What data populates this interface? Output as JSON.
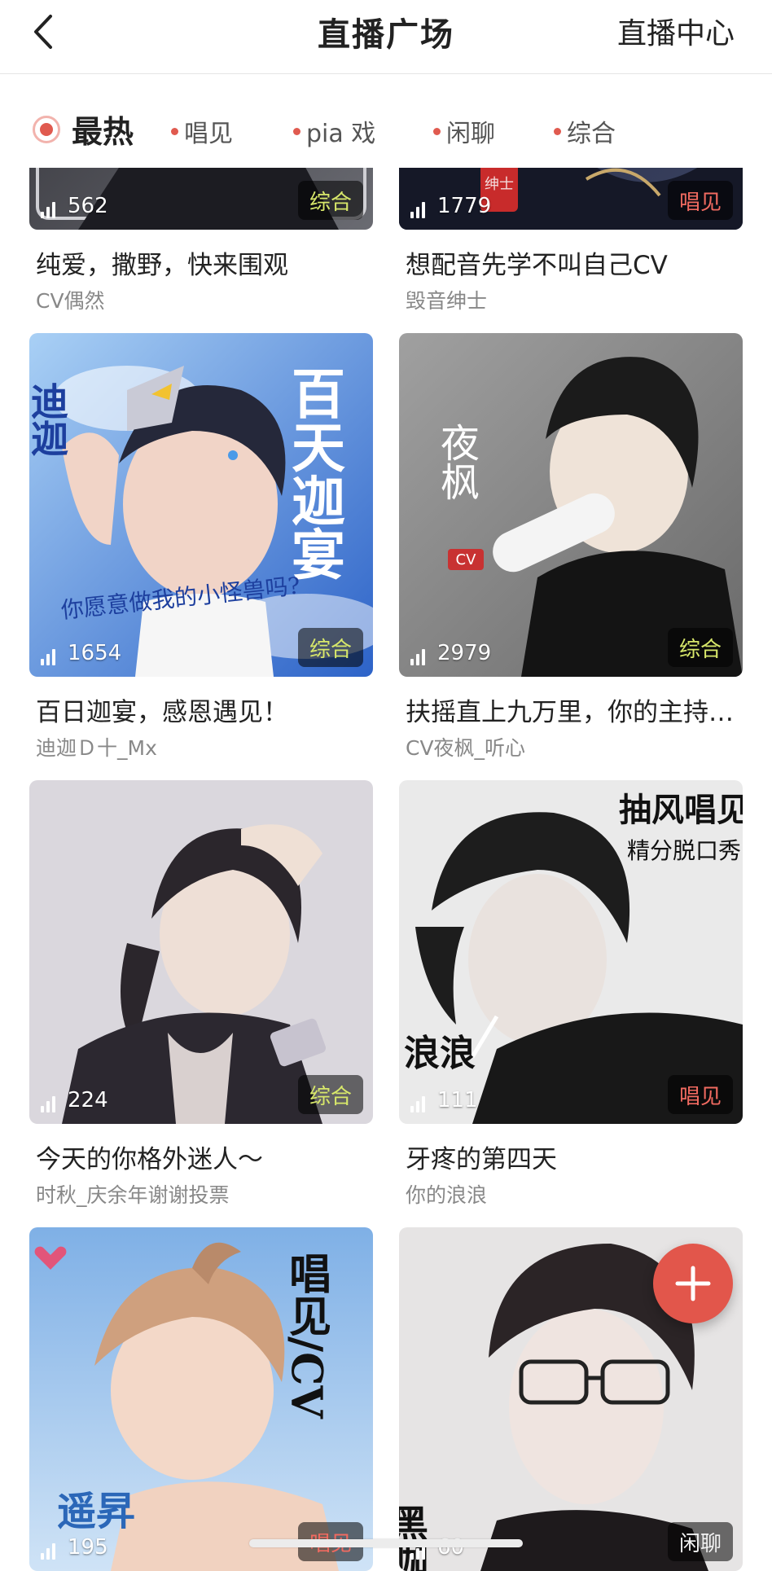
{
  "header": {
    "title": "直播广场",
    "right_action": "直播中心"
  },
  "filters": [
    {
      "label": "最热",
      "active": true
    },
    {
      "label": "唱见",
      "active": false
    },
    {
      "label": "pia 戏",
      "active": false
    },
    {
      "label": "闲聊",
      "active": false
    },
    {
      "label": "综合",
      "active": false
    }
  ],
  "cards": [
    {
      "count": "562",
      "tag": "综合",
      "title": "纯爱，撒野，快来围观",
      "author": "CV偶然",
      "tag_color": "#d8e86a",
      "palette": [
        "#2a2a30",
        "#55565e"
      ]
    },
    {
      "count": "1779",
      "tag": "唱见",
      "title": "想配音先学不叫自己CV",
      "author": "毁音绅士",
      "tag_color": "#f06a60",
      "palette": [
        "#1f2436",
        "#3b4363"
      ]
    },
    {
      "count": "1654",
      "tag": "综合",
      "title": "百日迦宴，感恩遇见！",
      "author": "迪迦Ｄ十_Mx",
      "tag_color": "#d8e86a",
      "palette": [
        "#6fa8e8",
        "#2d63c8"
      ]
    },
    {
      "count": "2979",
      "tag": "综合",
      "title": "扶摇直上九万里，你的主持…",
      "author": "CV夜枫_听心",
      "tag_color": "#d8e86a",
      "palette": [
        "#8c8c8c",
        "#2a2a2a"
      ]
    },
    {
      "count": "224",
      "tag": "综合",
      "title": "今天的你格外迷人～",
      "author": "时秋_庆余年谢谢投票",
      "tag_color": "#d8e86a",
      "palette": [
        "#d9d6dc",
        "#2f2a30"
      ]
    },
    {
      "count": "111",
      "tag": "唱见",
      "title": "牙疼的第四天",
      "author": "你的浪浪",
      "tag_color": "#f06a60",
      "palette": [
        "#e8e8e8",
        "#1d1d1d"
      ]
    },
    {
      "count": "195",
      "tag": "唱见",
      "title": "",
      "author": "",
      "tag_color": "#f06a60",
      "palette": [
        "#a9c9ee",
        "#e8c5a8"
      ]
    },
    {
      "count": "60",
      "tag": "闲聊",
      "title": "",
      "author": "",
      "tag_color": "#f2f2f2",
      "palette": [
        "#e4e4e4",
        "#2b2426"
      ]
    }
  ],
  "cover_texts": {
    "c1": "绅士",
    "c2_left": "迪迦",
    "c2_right": "百天迦宴",
    "c2_bottom": "你愿意做我的小怪兽吗?",
    "c3_name": "夜枫",
    "c3_badge": "CV",
    "c5_top": "抽风唱见",
    "c5_sub": "精分脱口秀",
    "c5_name": "浪浪",
    "c6_side": "唱见/CV",
    "c6_name": "遥昇",
    "c7_name": "黑咖"
  },
  "fab_label": "+"
}
